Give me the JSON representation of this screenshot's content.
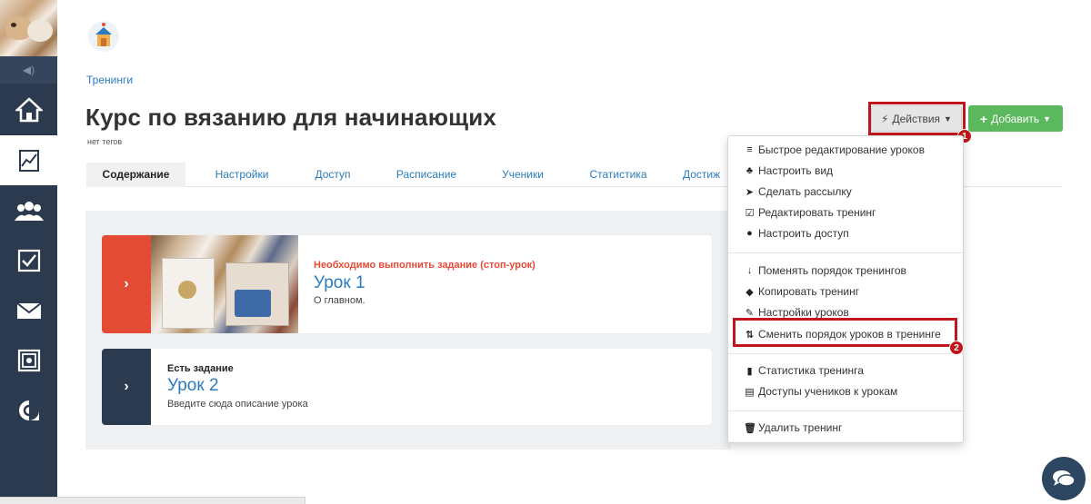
{
  "sidebar": {
    "collapse_icon": "speaker-icon",
    "items": [
      {
        "icon": "home-icon",
        "active": false
      },
      {
        "icon": "chart-icon",
        "active": true
      },
      {
        "icon": "users-icon",
        "active": false
      },
      {
        "icon": "checkbox-icon",
        "active": false
      },
      {
        "icon": "envelope-icon",
        "active": false
      },
      {
        "icon": "safe-icon",
        "active": false
      },
      {
        "icon": "copyright-icon",
        "active": false
      }
    ]
  },
  "breadcrumb": {
    "label": "Тренинги"
  },
  "page": {
    "title": "Курс по вязанию для начинающих",
    "tags": "нет тегов"
  },
  "actions": {
    "label": "Действия",
    "badge": "1"
  },
  "add": {
    "label": "Добавить"
  },
  "tabs": [
    {
      "label": "Содержание"
    },
    {
      "label": "Настройки"
    },
    {
      "label": "Доступ"
    },
    {
      "label": "Расписание"
    },
    {
      "label": "Ученики"
    },
    {
      "label": "Статистика"
    },
    {
      "label": "Достиж"
    }
  ],
  "lessons": [
    {
      "status": "Необходимо выполнить задание (стоп-урок)",
      "title": "Урок 1",
      "description": "О главном.",
      "accent": "#e44b35"
    },
    {
      "status": "Есть задание",
      "title": "Урок 2",
      "description": "Введите сюда описание урока",
      "accent": "#2b3a4e"
    }
  ],
  "dropdown": {
    "groups": [
      [
        {
          "label": "Быстрое редактирование уроков",
          "icon": "list-icon"
        },
        {
          "label": "Настроить вид",
          "icon": "sitemap-icon"
        },
        {
          "label": "Сделать рассылку",
          "icon": "paper-plane-icon"
        },
        {
          "label": "Редактировать тренинг",
          "icon": "edit-icon"
        },
        {
          "label": "Настроить доступ",
          "icon": "user-icon"
        }
      ],
      [
        {
          "label": "Поменять порядок тренингов",
          "icon": "sort-icon"
        },
        {
          "label": "Копировать тренинг",
          "icon": "tags-icon"
        },
        {
          "label": "Настройки уроков",
          "icon": "wrench-icon"
        },
        {
          "label": "Сменить порядок уроков в тренинге",
          "icon": "sort-arrows-icon"
        }
      ],
      [
        {
          "label": "Статистика тренинга",
          "icon": "bar-chart-icon"
        },
        {
          "label": "Доступы учеников к урокам",
          "icon": "table-icon"
        }
      ],
      [
        {
          "label": "Удалить тренинг",
          "icon": "trash-icon"
        }
      ]
    ],
    "highlight_badge": "2"
  },
  "colors": {
    "sidebar": "#2b3a4e",
    "link": "#2c7bbf",
    "success": "#5cb85c",
    "highlight": "#c0161b",
    "warning": "#e44b35"
  }
}
